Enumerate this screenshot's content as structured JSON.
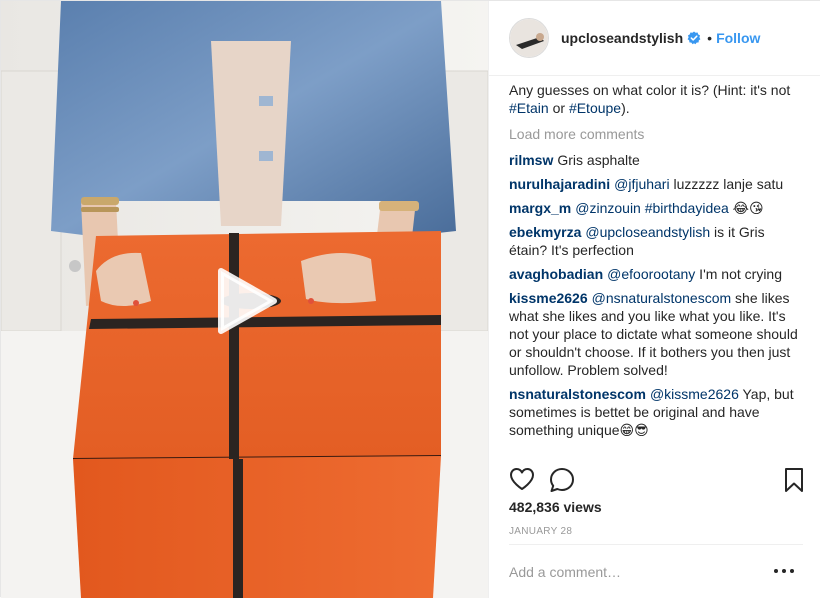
{
  "post": {
    "username": "upcloseandstylish",
    "follow_label": "Follow",
    "separator": "•",
    "caption": {
      "text_before": "Any guesses on what color it is? (Hint: it's not ",
      "tag1": "#Etain",
      "text_mid": " or ",
      "tag2": "#Etoupe",
      "text_after": ")."
    },
    "load_more_label": "Load more comments",
    "comments": [
      {
        "user": "rilmsw",
        "parts": [
          {
            "t": "text",
            "v": "Gris asphalte"
          }
        ]
      },
      {
        "user": "nurulhajaradini",
        "parts": [
          {
            "t": "link",
            "v": "@jfjuhari"
          },
          {
            "t": "text",
            "v": " luzzzzz lanje satu"
          }
        ]
      },
      {
        "user": "margx_m",
        "parts": [
          {
            "t": "link",
            "v": "@zinzouin"
          },
          {
            "t": "text",
            "v": " "
          },
          {
            "t": "link",
            "v": "#birthdayidea"
          },
          {
            "t": "text",
            "v": " 😂😘"
          }
        ]
      },
      {
        "user": "ebekmyrza",
        "parts": [
          {
            "t": "link",
            "v": "@upcloseandstylish"
          },
          {
            "t": "text",
            "v": " is it Gris étain? It's perfection"
          }
        ]
      },
      {
        "user": "avaghobadian",
        "parts": [
          {
            "t": "link",
            "v": "@efoorootany"
          },
          {
            "t": "text",
            "v": " I'm not crying"
          }
        ]
      },
      {
        "user": "kissme2626",
        "parts": [
          {
            "t": "link",
            "v": "@nsnaturalstonescom"
          },
          {
            "t": "text",
            "v": " she likes what she likes and you like what you like. It's not your place to dictate what someone should or shouldn't choose. If it bothers you then just unfollow. Problem solved!"
          }
        ]
      },
      {
        "user": "nsnaturalstonescom",
        "parts": [
          {
            "t": "link",
            "v": "@kissme2626"
          },
          {
            "t": "text",
            "v": " Yap, but sometimes is bettet be original and have something unique😁😎"
          }
        ]
      }
    ],
    "views": "482,836 views",
    "date": "JANUARY 28",
    "add_comment_placeholder": "Add a comment…"
  },
  "icons": {
    "verified": "verified-badge-icon",
    "like": "heart-icon",
    "comment": "comment-bubble-icon",
    "save": "bookmark-icon",
    "more": "more-options-icon",
    "play": "play-icon"
  },
  "colors": {
    "accent": "#3897f0",
    "link": "#003569",
    "muted": "#999999",
    "box_orange": "#e8622a"
  }
}
